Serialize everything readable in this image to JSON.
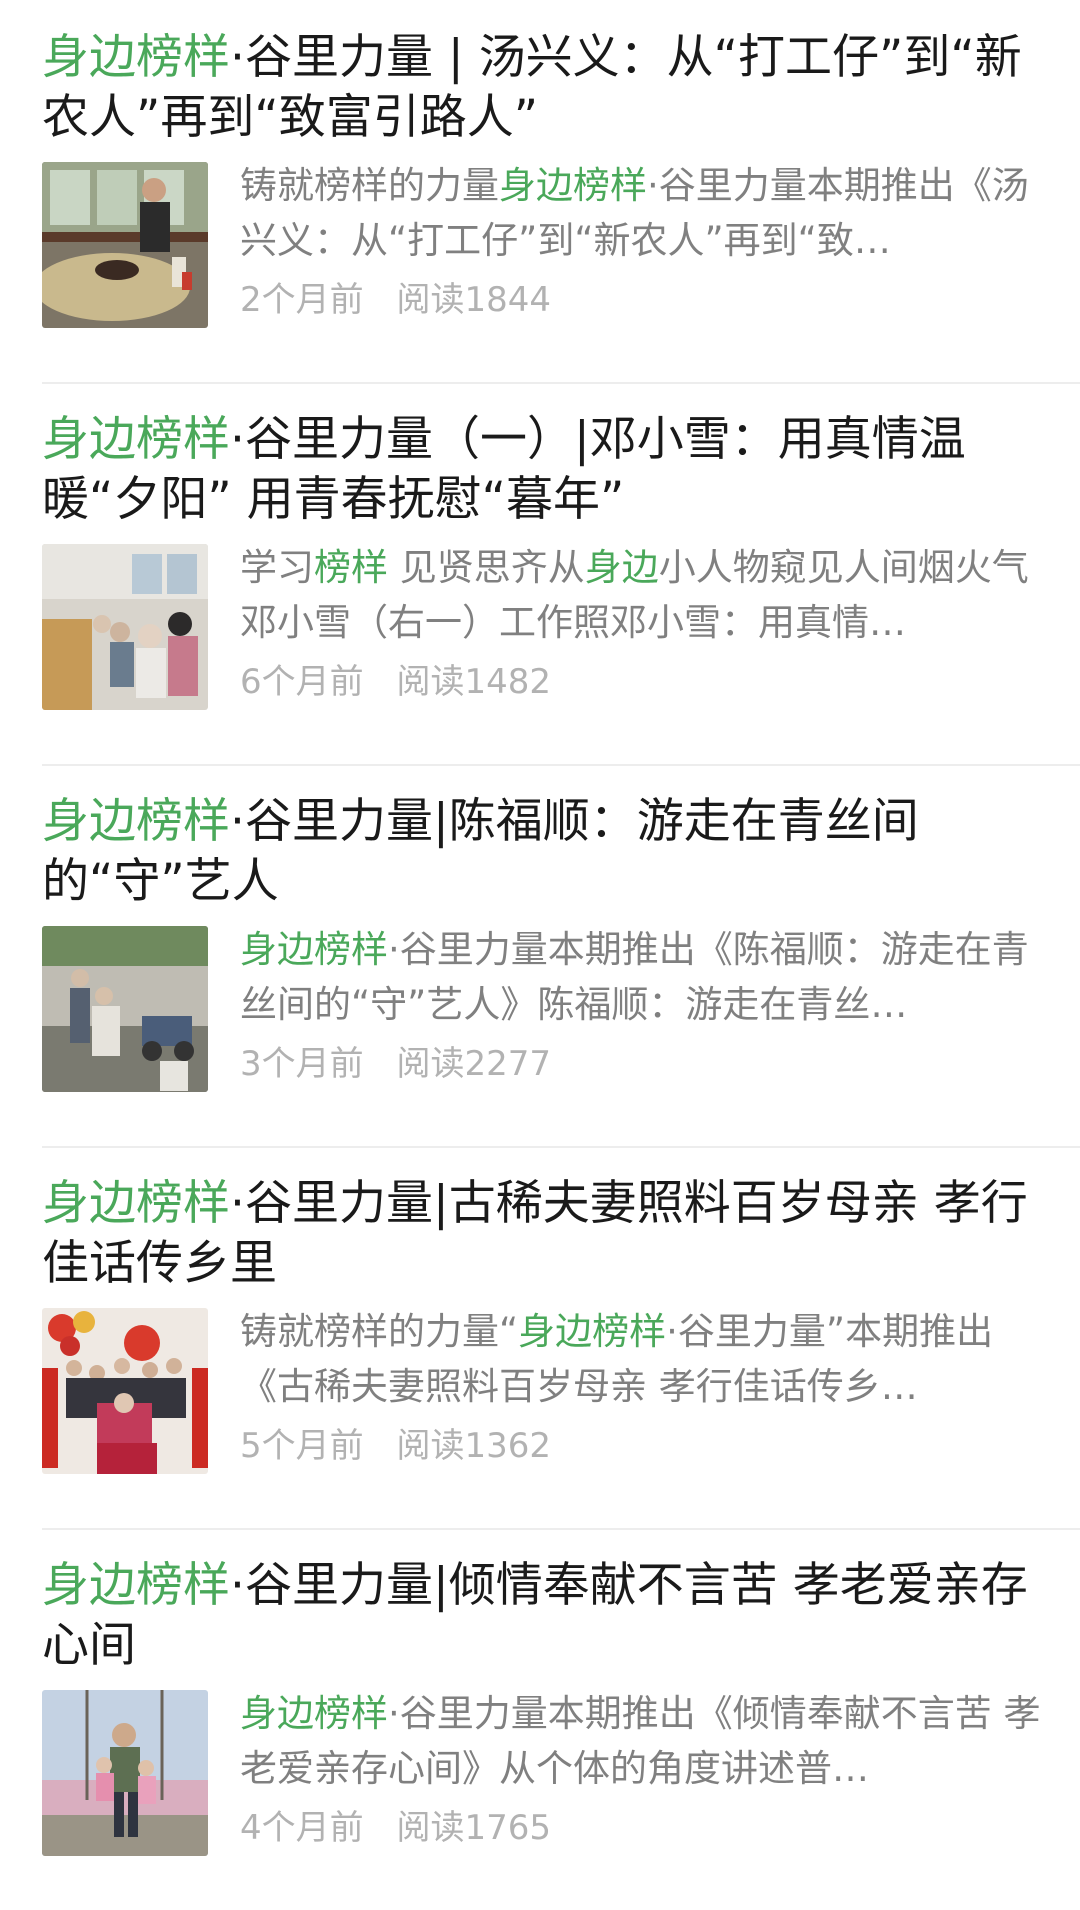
{
  "articles": [
    {
      "title_prefix": "身边榜样",
      "title_rest": "·谷里力量 | 汤兴义：从“打工仔”到“新农人”再到“致富引路人”",
      "desc_pre": "铸就榜样的力量",
      "desc_hl": "身边榜样",
      "desc_post": "·谷里力量本期推出《汤兴义：从“打工仔”到“新农人”再到“致…",
      "time": "2个月前",
      "reads": "阅读1844"
    },
    {
      "title_prefix": "身边榜样",
      "title_rest": "·谷里力量（一）|邓小雪：用真情温暖“夕阳” 用青春抚慰“暮年”",
      "desc_pre": "学习",
      "desc_hl": "榜样",
      "desc_mid": " 见贤思齐从",
      "desc_hl2": "身边",
      "desc_post": "小人物窥见人间烟火气邓小雪（右一）工作照邓小雪：用真情…",
      "time": "6个月前",
      "reads": "阅读1482"
    },
    {
      "title_prefix": "身边榜样",
      "title_rest": "·谷里力量|陈福顺：游走在青丝间的“守”艺人",
      "desc_pre": "",
      "desc_hl": "身边榜样",
      "desc_post": "·谷里力量本期推出《陈福顺：游走在青丝间的“守”艺人》陈福顺：游走在青丝…",
      "time": "3个月前",
      "reads": "阅读2277"
    },
    {
      "title_prefix": "身边榜样",
      "title_rest": "·谷里力量|古稀夫妻照料百岁母亲 孝行佳话传乡里",
      "desc_pre": "铸就榜样的力量“",
      "desc_hl": "身边榜样",
      "desc_post": "·谷里力量”本期推出《古稀夫妻照料百岁母亲 孝行佳话传乡…",
      "time": "5个月前",
      "reads": "阅读1362"
    },
    {
      "title_prefix": "身边榜样",
      "title_rest": "·谷里力量|倾情奉献不言苦 孝老爱亲存心间",
      "desc_pre": "",
      "desc_hl": "身边榜样",
      "desc_post": "·谷里力量本期推出《倾情奉献不言苦 孝老爱亲存心间》从个体的角度讲述普…",
      "time": "4个月前",
      "reads": "阅读1765"
    }
  ],
  "colors": {
    "highlight": "#4aa85a",
    "title": "#1a1a1a",
    "desc": "#808080",
    "meta": "#b2b2b2"
  },
  "icons": [
    "thumbnail-photo-kitchen",
    "thumbnail-photo-nursing-home",
    "thumbnail-photo-barber",
    "thumbnail-photo-family-birthday",
    "thumbnail-photo-swing"
  ]
}
